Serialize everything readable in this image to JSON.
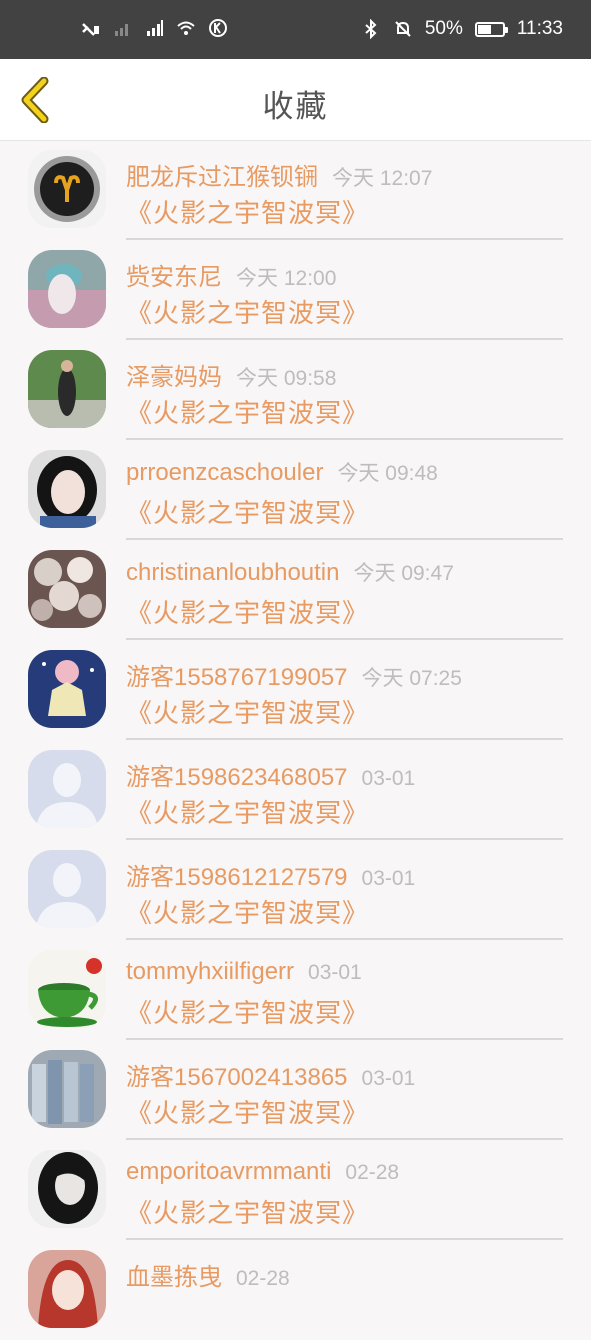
{
  "status_bar": {
    "battery_percent": "50%",
    "battery_level": 0.5,
    "time": "11:33"
  },
  "header": {
    "title": "收藏"
  },
  "items": [
    {
      "name": "肥龙斥过江猴钡锎",
      "time": "今天 12:07",
      "book": "《火影之宇智波冥》"
    },
    {
      "name": "赀安东尼",
      "time": "今天 12:00",
      "book": "《火影之宇智波冥》"
    },
    {
      "name": "泽豪妈妈",
      "time": "今天 09:58",
      "book": "《火影之宇智波冥》"
    },
    {
      "name": "prroenzcaschouler",
      "time": "今天 09:48",
      "book": "《火影之宇智波冥》"
    },
    {
      "name": "christinanloubhoutin",
      "time": "今天 09:47",
      "book": "《火影之宇智波冥》"
    },
    {
      "name": "游客1558767199057",
      "time": "今天 07:25",
      "book": "《火影之宇智波冥》"
    },
    {
      "name": "游客1598623468057",
      "time": "03-01",
      "book": "《火影之宇智波冥》"
    },
    {
      "name": "游客1598612127579",
      "time": "03-01",
      "book": "《火影之宇智波冥》"
    },
    {
      "name": "tommyhxiilfigerr",
      "time": "03-01",
      "book": "《火影之宇智波冥》"
    },
    {
      "name": "游客1567002413865",
      "time": "03-01",
      "book": "《火影之宇智波冥》"
    },
    {
      "name": "emporitoavrmmanti",
      "time": "02-28",
      "book": "《火影之宇智波冥》"
    },
    {
      "name": "血墨拣曳",
      "time": "02-28",
      "book": ""
    }
  ]
}
